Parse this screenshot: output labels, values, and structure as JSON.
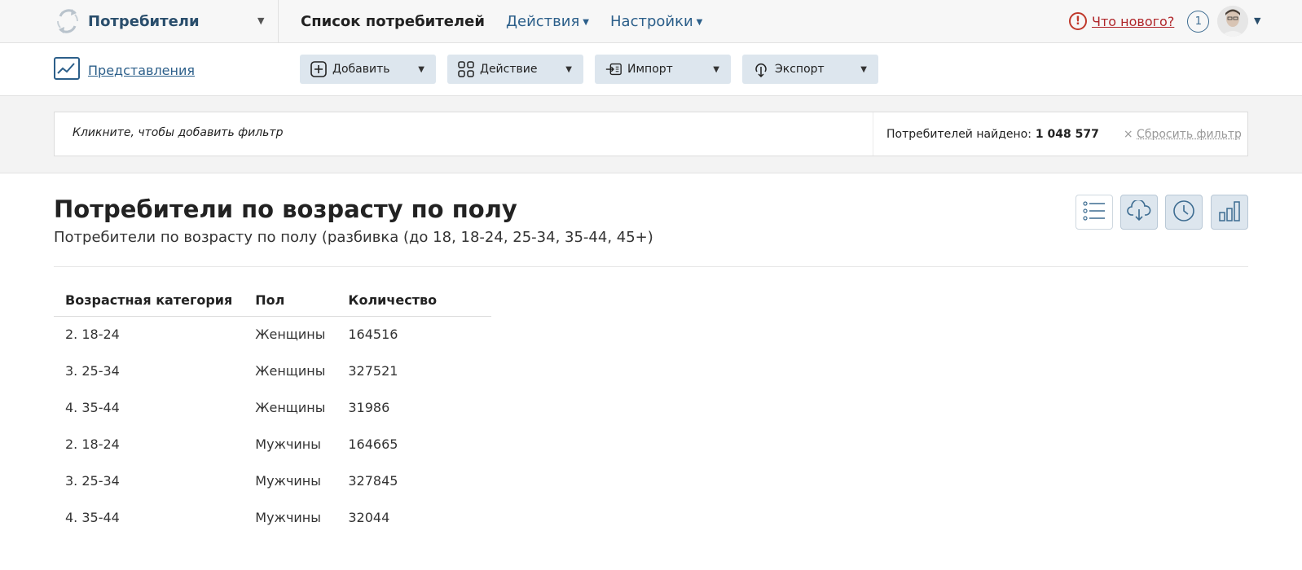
{
  "app": {
    "name": "Потребители"
  },
  "nav": {
    "items": [
      {
        "label": "Список потребителей"
      },
      {
        "label": "Действия"
      },
      {
        "label": "Настройки"
      }
    ]
  },
  "header": {
    "whats_new": "Что нового?",
    "whats_new_icon": "!",
    "notification_count": "1"
  },
  "toolbar": {
    "views_label": "Представления",
    "buttons": [
      {
        "label": "Добавить",
        "icon": "plus-square-icon"
      },
      {
        "label": "Действие",
        "icon": "grid-icon"
      },
      {
        "label": "Импорт",
        "icon": "import-icon"
      },
      {
        "label": "Экспорт",
        "icon": "export-icon"
      }
    ]
  },
  "filter": {
    "hint": "Кликните, чтобы добавить фильтр",
    "found_label": "Потребителей найдено:",
    "found_count": "1 048 577",
    "reset_x": "×",
    "reset_label": "Сбросить фильтр"
  },
  "report": {
    "title": "Потребители по возрасту по полу",
    "subtitle": "Потребители по возрасту по полу (разбивка (до 18, 18-24, 25-34, 35-44, 45+)",
    "actions": [
      {
        "icon": "list-icon",
        "active": false
      },
      {
        "icon": "cloud-download-icon",
        "active": true
      },
      {
        "icon": "clock-icon",
        "active": true
      },
      {
        "icon": "bar-chart-icon",
        "active": true
      }
    ]
  },
  "table": {
    "columns": [
      "Возрастная категория",
      "Пол",
      "Количество"
    ],
    "rows": [
      [
        "2. 18-24",
        "Женщины",
        "164516"
      ],
      [
        "3. 25-34",
        "Женщины",
        "327521"
      ],
      [
        "4. 35-44",
        "Женщины",
        "31986"
      ],
      [
        "2. 18-24",
        "Мужчины",
        "164665"
      ],
      [
        "3. 25-34",
        "Мужчины",
        "327845"
      ],
      [
        "4. 35-44",
        "Мужчины",
        "32044"
      ]
    ]
  },
  "colors": {
    "brand": "#2a4e6c",
    "link": "#2c5f8a",
    "alert": "#c0392b",
    "button_bg": "#dde6ee"
  }
}
